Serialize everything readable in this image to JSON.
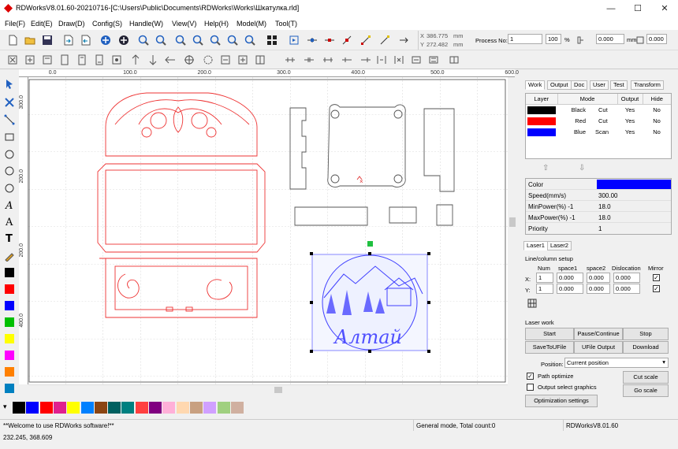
{
  "window": {
    "title": "RDWorksV8.01.60-20210716-[C:\\Users\\Public\\Documents\\RDWorks\\Works\\Шкатулка.rld]"
  },
  "menu": [
    "File(F)",
    "Edit(E)",
    "Draw(D)",
    "Config(S)",
    "Handle(W)",
    "View(V)",
    "Help(H)",
    "Model(M)",
    "Tool(T)"
  ],
  "toolbar": {
    "x_readout": "386.775",
    "y_readout": "272.482",
    "unit_mm": "mm",
    "process_no_label": "Process No:",
    "process_no": "1",
    "percent_val": "100",
    "percent": "%",
    "size_w": "0.000",
    "size_h": "0.000",
    "size_unit": "mm"
  },
  "ruler": {
    "top": [
      [
        "0.0",
        0.06
      ],
      [
        "100.0",
        0.21
      ],
      [
        "200.0",
        0.36
      ],
      [
        "300.0",
        0.52
      ],
      [
        "400.0",
        0.67
      ],
      [
        "500.0",
        0.83
      ],
      [
        "600.0",
        0.98
      ]
    ],
    "left": [
      [
        "300.0",
        0.06
      ],
      [
        "200.0",
        0.3
      ],
      [
        "200.0",
        0.54
      ],
      [
        "400.0",
        0.77
      ]
    ]
  },
  "palette_colors": [
    "#000000",
    "#0000ff",
    "#ff0000",
    "#e0208f",
    "#ffff00",
    "#0080ff",
    "#8b4513",
    "#006060",
    "#008080",
    "#ff4040",
    "#800080",
    "#ffb0d8",
    "#ffd8b0",
    "#c8a080",
    "#d0a0ff",
    "#a0d080",
    "#d0b0a0"
  ],
  "palette_first": [
    "#000000",
    "#0000ff",
    "#ff0000",
    "#ff00ff",
    "#ff8000"
  ],
  "left_swatches": [
    "#000000",
    "#ff0000",
    "#0000ff",
    "#00c000",
    "#ffff00",
    "#ff00ff",
    "#ff8000",
    "#0080c0",
    "#8080ff"
  ],
  "tabs": [
    "Work",
    "Output",
    "Doc",
    "User",
    "Test",
    "Transform"
  ],
  "layer_table": {
    "headers": [
      "Layer",
      "Mode",
      "Output",
      "Hide"
    ],
    "rows": [
      {
        "color": "#000000",
        "name": "Black",
        "mode": "Cut",
        "output": "Yes",
        "hide": "No"
      },
      {
        "color": "#ff0000",
        "name": "Red",
        "mode": "Cut",
        "output": "Yes",
        "hide": "No"
      },
      {
        "color": "#0000ff",
        "name": "Blue",
        "mode": "Scan",
        "output": "Yes",
        "hide": "No"
      }
    ]
  },
  "props": [
    {
      "label": "Color",
      "value": ""
    },
    {
      "label": "Speed(mm/s)",
      "value": "300.00"
    },
    {
      "label": "MinPower(%) -1",
      "value": "18.0"
    },
    {
      "label": "MaxPower(%) -1",
      "value": "18.0"
    },
    {
      "label": "Priority",
      "value": "1"
    }
  ],
  "prop_color": "#0000ff",
  "laser_tabs": [
    "Laser1",
    "Laser2"
  ],
  "line_col": {
    "title": "Line/column setup",
    "headers": [
      "Num",
      "space1",
      "space2",
      "Dislocation",
      "Mirror"
    ],
    "x_label": "X:",
    "y_label": "Y:",
    "x": [
      "1",
      "0.000",
      "0.000",
      "0.000"
    ],
    "y": [
      "1",
      "0.000",
      "0.000",
      "0.000"
    ]
  },
  "laser_work": {
    "title": "Laser work",
    "buttons": [
      "Start",
      "Pause/Continue",
      "Stop",
      "SaveToUFile",
      "UFile Output",
      "Download"
    ],
    "position_label": "Position:",
    "position_value": "Current position",
    "path_optimize": "Path optimize",
    "output_select": "Output select graphics",
    "cut_scale": "Cut scale",
    "go_scale": "Go scale",
    "opt_settings": "Optimization settings"
  },
  "status": {
    "left": "**Welcome to use RDWorks software!**",
    "mid": "General mode, Total count:0",
    "right": "RDWorksV8.01.60"
  },
  "cursor_coords": "232.245, 368.609"
}
